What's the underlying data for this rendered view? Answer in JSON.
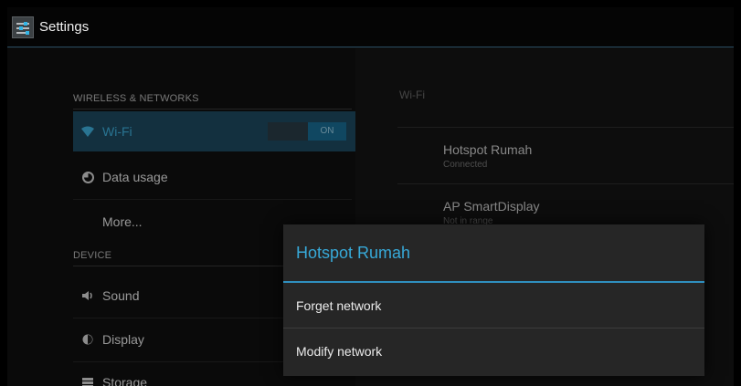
{
  "app": {
    "title": "Settings",
    "icon": "settings-sliders-icon"
  },
  "sidebar": {
    "sections": [
      {
        "header": "WIRELESS & NETWORKS"
      },
      {
        "header": "DEVICE"
      }
    ],
    "items": [
      {
        "label": "Wi-Fi",
        "icon": "wifi-icon",
        "toggle": "ON"
      },
      {
        "label": "Data usage",
        "icon": "data-usage-icon"
      },
      {
        "label": "More..."
      },
      {
        "label": "Sound",
        "icon": "sound-icon"
      },
      {
        "label": "Display",
        "icon": "display-icon"
      },
      {
        "label": "Storage",
        "icon": "storage-icon"
      }
    ]
  },
  "detail": {
    "title": "Wi-Fi",
    "networks": [
      {
        "name": "Hotspot Rumah",
        "status": "Connected"
      },
      {
        "name": "AP SmartDisplay",
        "status": "Not in range"
      }
    ]
  },
  "dialog": {
    "title": "Hotspot Rumah",
    "options": [
      "Forget network",
      "Modify network"
    ]
  },
  "colors": {
    "accent": "#33b5e5",
    "selected_bg": "#1e4a62"
  }
}
